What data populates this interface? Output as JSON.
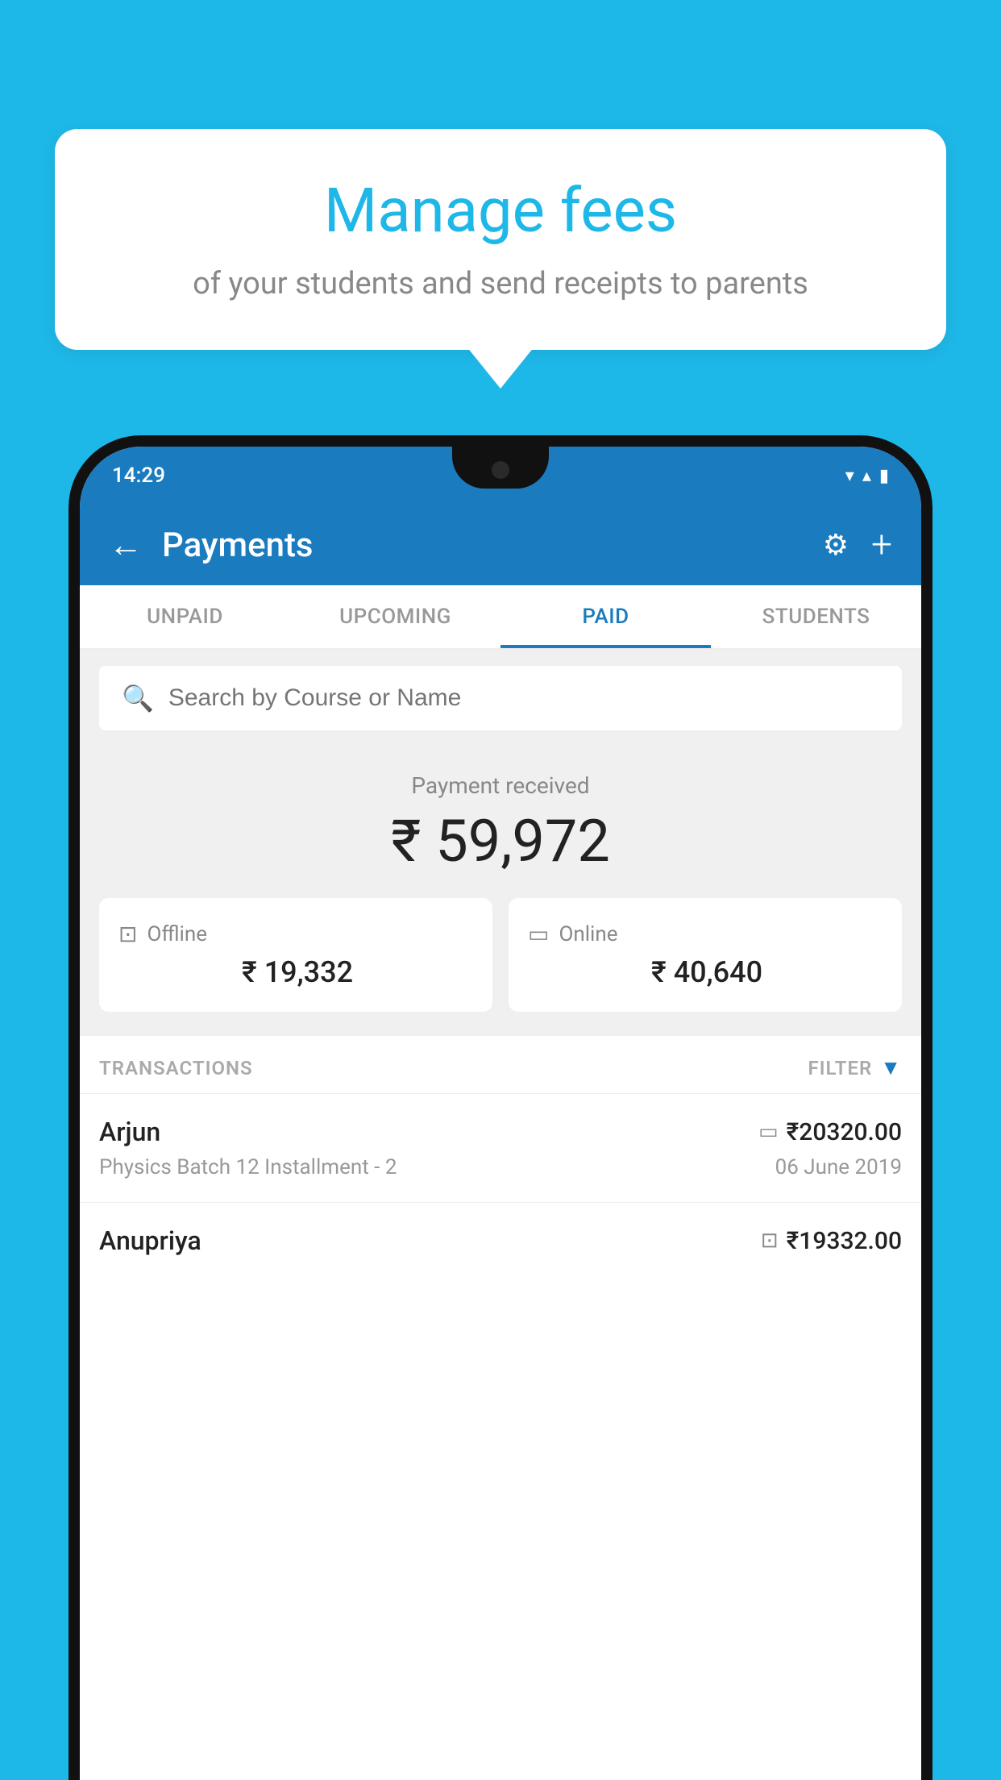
{
  "background_color": "#1eb8e8",
  "bubble": {
    "title": "Manage fees",
    "subtitle": "of your students and send receipts to parents"
  },
  "status_bar": {
    "time": "14:29",
    "wifi_icon": "▼",
    "signal_icon": "▲",
    "battery_icon": "▮"
  },
  "header": {
    "title": "Payments",
    "back_label": "←",
    "settings_label": "⚙",
    "add_label": "+"
  },
  "tabs": [
    {
      "label": "UNPAID",
      "active": false
    },
    {
      "label": "UPCOMING",
      "active": false
    },
    {
      "label": "PAID",
      "active": true
    },
    {
      "label": "STUDENTS",
      "active": false
    }
  ],
  "search": {
    "placeholder": "Search by Course or Name"
  },
  "payment_summary": {
    "label": "Payment received",
    "total_amount": "₹ 59,972",
    "offline_label": "Offline",
    "offline_amount": "₹ 19,332",
    "online_label": "Online",
    "online_amount": "₹ 40,640"
  },
  "transactions_section": {
    "label": "TRANSACTIONS",
    "filter_label": "FILTER"
  },
  "transactions": [
    {
      "name": "Arjun",
      "course": "Physics Batch 12 Installment - 2",
      "amount": "₹20320.00",
      "date": "06 June 2019",
      "payment_type": "online"
    },
    {
      "name": "Anupriya",
      "course": "",
      "amount": "₹19332.00",
      "date": "",
      "payment_type": "offline"
    }
  ]
}
